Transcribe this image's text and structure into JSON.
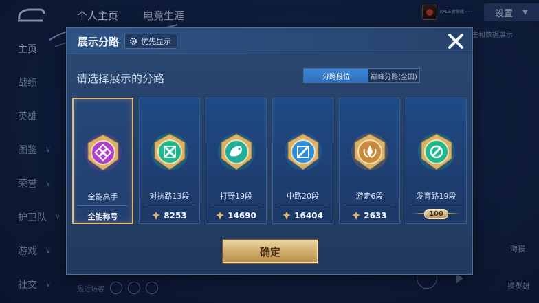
{
  "background": {
    "top_tabs": [
      "个人主页",
      "电竞生涯"
    ],
    "settings_label": "设置",
    "tiny_header_text": "KPL王者荣耀 · · ·",
    "sidebar_items": [
      {
        "label": "主页",
        "active": true,
        "chevron": false
      },
      {
        "label": "战绩",
        "active": false,
        "chevron": false
      },
      {
        "label": "英雄",
        "active": false,
        "chevron": false
      },
      {
        "label": "图鉴",
        "active": false,
        "chevron": true
      },
      {
        "label": "荣誉",
        "active": false,
        "chevron": true
      },
      {
        "label": "护卫队",
        "active": false,
        "chevron": true
      },
      {
        "label": "游戏",
        "active": false,
        "chevron": true
      },
      {
        "label": "社交",
        "active": false,
        "chevron": true
      }
    ],
    "right_partial_text": "主和数据展示",
    "bottom_text": "最近访客",
    "poster_label": "海报",
    "change_hero_label": "换英雄"
  },
  "dialog": {
    "title": "展示分路",
    "priority_label": "优先显示",
    "subtitle": "请选择展示的分路",
    "tabs": [
      {
        "label": "分路段位",
        "active": true
      },
      {
        "label": "巅峰分路(全国)",
        "active": false
      }
    ],
    "cards": [
      {
        "name": "全能高手",
        "footer_text": "全能称号",
        "selected": true,
        "icon": "all-round-emblem-icon",
        "color": "#b23fd0"
      },
      {
        "name": "对抗路13段",
        "footer_value": "8253",
        "selected": false,
        "icon": "clash-lane-emblem-icon",
        "color": "#1fb98f"
      },
      {
        "name": "打野19段",
        "footer_value": "14690",
        "selected": false,
        "icon": "jungle-emblem-icon",
        "color": "#1fae9a"
      },
      {
        "name": "中路20段",
        "footer_value": "16404",
        "selected": false,
        "icon": "mid-lane-emblem-icon",
        "color": "#2b8fe0"
      },
      {
        "name": "游走6段",
        "footer_value": "2633",
        "selected": false,
        "icon": "roam-emblem-icon",
        "color": "#c98a3c"
      },
      {
        "name": "发育路19段",
        "footer_badge": "100",
        "selected": false,
        "icon": "farm-lane-emblem-icon",
        "color": "#1fb98f"
      }
    ],
    "confirm_label": "确定"
  },
  "colors": {
    "gold": "#e1b978",
    "accent_blue": "#3f86d6",
    "dialog_bg": "#2a4873"
  }
}
